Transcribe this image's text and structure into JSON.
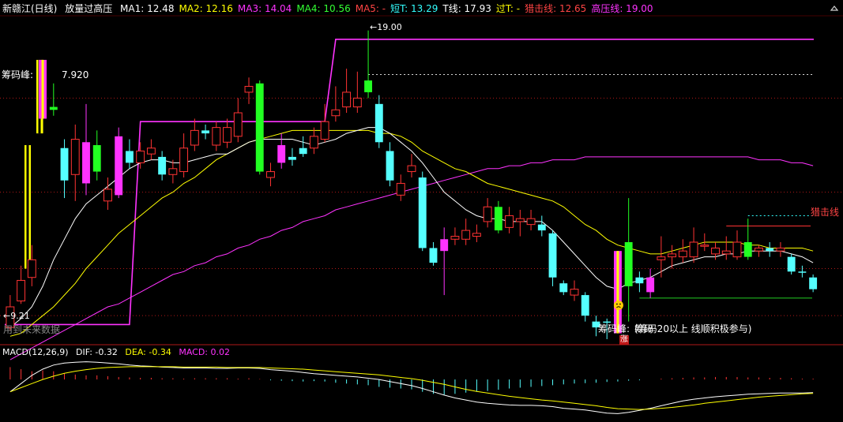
{
  "header": {
    "stock": "新赣江(日线)",
    "indicator": "放量过高压",
    "ma": [
      {
        "text": "MA1: 12.48",
        "color": "#ffffff"
      },
      {
        "text": "MA2: 12.16",
        "color": "#ffff00"
      },
      {
        "text": "MA3: 14.04",
        "color": "#ff33ff"
      },
      {
        "text": "MA4: 10.56",
        "color": "#33ff33"
      },
      {
        "text": "MA5: -",
        "color": "#ff4444"
      }
    ],
    "extra": [
      {
        "text": "短T: 13.29",
        "color": "#33ffff"
      },
      {
        "text": "T线: 17.93",
        "color": "#ffffff"
      },
      {
        "text": "过T: -",
        "color": "#ffff00"
      },
      {
        "text": "猎击线: 12.65",
        "color": "#ff4444"
      },
      {
        "text": "高压线: 19.00",
        "color": "#ff33ff"
      }
    ]
  },
  "labels": {
    "chip_peak_left": "筹码峰:",
    "chip_peak_value": "7.920",
    "high_marker": "←19.00",
    "low_marker": "←9.21",
    "future_data": "用到未来数据",
    "right_line": "猎击线",
    "chip_peak_bottom": "筹码峰:",
    "chip_note": "(筹码20以上 线顺积极参与)",
    "chip_overlap": "筹码",
    "rise_badge": "涨",
    "face_icon": "sad-face-icon"
  },
  "macd": {
    "title": "MACD(12,26,9)",
    "dif": "DIF: -0.32",
    "dea": "DEA: -0.34",
    "macd": "MACD: 0.02"
  },
  "colors": {
    "up": "#ff3333",
    "down": "#55ffff",
    "green": "#22ff22",
    "magenta": "#ff33ff",
    "yellow": "#ffff00",
    "white": "#ffffff",
    "grid": "#b01818"
  },
  "chart_data": {
    "type": "candlestick",
    "y_range": [
      8.8,
      19.8
    ],
    "resistance_line": 19.0,
    "stop_line": 12.65,
    "candles": [
      {
        "o": 9.2,
        "c": 9.9,
        "h": 10.3,
        "l": 9.1,
        "t": "up"
      },
      {
        "o": 10.1,
        "c": 10.8,
        "h": 11.3,
        "l": 10.0,
        "t": "up"
      },
      {
        "o": 10.9,
        "c": 11.5,
        "h": 12.0,
        "l": 10.6,
        "t": "up"
      },
      {
        "o": 18.3,
        "c": 16.3,
        "h": 18.3,
        "l": 15.8,
        "t": "yellow"
      },
      {
        "o": 16.7,
        "c": 16.6,
        "h": 17.5,
        "l": 16.4,
        "t": "green"
      },
      {
        "o": 15.3,
        "c": 14.2,
        "h": 15.6,
        "l": 13.6,
        "t": "down"
      },
      {
        "o": 14.4,
        "c": 15.6,
        "h": 16.1,
        "l": 13.5,
        "t": "up"
      },
      {
        "o": 15.5,
        "c": 14.1,
        "h": 16.8,
        "l": 13.7,
        "t": "magenta"
      },
      {
        "o": 14.5,
        "c": 15.4,
        "h": 15.9,
        "l": 14.2,
        "t": "green"
      },
      {
        "o": 13.5,
        "c": 13.9,
        "h": 14.3,
        "l": 13.2,
        "t": "up"
      },
      {
        "o": 13.7,
        "c": 15.7,
        "h": 16.0,
        "l": 13.6,
        "t": "magenta"
      },
      {
        "o": 15.2,
        "c": 14.8,
        "h": 15.6,
        "l": 14.6,
        "t": "down"
      },
      {
        "o": 14.8,
        "c": 15.2,
        "h": 15.5,
        "l": 14.6,
        "t": "up"
      },
      {
        "o": 15.3,
        "c": 15.1,
        "h": 15.6,
        "l": 14.9,
        "t": "up"
      },
      {
        "o": 15.0,
        "c": 14.4,
        "h": 15.2,
        "l": 14.2,
        "t": "down"
      },
      {
        "o": 14.4,
        "c": 14.6,
        "h": 14.9,
        "l": 14.1,
        "t": "up"
      },
      {
        "o": 14.5,
        "c": 15.3,
        "h": 15.8,
        "l": 14.3,
        "t": "up"
      },
      {
        "o": 15.4,
        "c": 15.9,
        "h": 16.3,
        "l": 15.2,
        "t": "up"
      },
      {
        "o": 15.9,
        "c": 15.8,
        "h": 16.1,
        "l": 15.6,
        "t": "down"
      },
      {
        "o": 15.4,
        "c": 16.0,
        "h": 16.2,
        "l": 15.2,
        "t": "up"
      },
      {
        "o": 16.0,
        "c": 15.5,
        "h": 16.3,
        "l": 15.3,
        "t": "up"
      },
      {
        "o": 15.7,
        "c": 16.5,
        "h": 17.0,
        "l": 15.5,
        "t": "up"
      },
      {
        "o": 17.2,
        "c": 17.4,
        "h": 17.7,
        "l": 16.8,
        "t": "up"
      },
      {
        "o": 17.5,
        "c": 14.5,
        "h": 17.6,
        "l": 14.4,
        "t": "green"
      },
      {
        "o": 14.5,
        "c": 14.3,
        "h": 14.8,
        "l": 14.0,
        "t": "up"
      },
      {
        "o": 14.8,
        "c": 15.4,
        "h": 15.8,
        "l": 14.6,
        "t": "magenta"
      },
      {
        "o": 15.0,
        "c": 14.9,
        "h": 15.3,
        "l": 14.7,
        "t": "down"
      },
      {
        "o": 15.3,
        "c": 15.1,
        "h": 15.7,
        "l": 15.0,
        "t": "down"
      },
      {
        "o": 15.7,
        "c": 15.3,
        "h": 16.0,
        "l": 15.1,
        "t": "up"
      },
      {
        "o": 15.6,
        "c": 16.2,
        "h": 16.8,
        "l": 15.5,
        "t": "up"
      },
      {
        "o": 16.4,
        "c": 16.6,
        "h": 17.4,
        "l": 16.2,
        "t": "up"
      },
      {
        "o": 16.7,
        "c": 17.2,
        "h": 18.0,
        "l": 16.5,
        "t": "up"
      },
      {
        "o": 17.0,
        "c": 16.7,
        "h": 17.9,
        "l": 16.5,
        "t": "up"
      },
      {
        "o": 17.6,
        "c": 17.2,
        "h": 19.3,
        "l": 17.0,
        "t": "green"
      },
      {
        "o": 16.8,
        "c": 15.5,
        "h": 17.1,
        "l": 15.3,
        "t": "down"
      },
      {
        "o": 15.2,
        "c": 14.2,
        "h": 15.5,
        "l": 14.0,
        "t": "down"
      },
      {
        "o": 14.1,
        "c": 13.7,
        "h": 14.4,
        "l": 13.5,
        "t": "up"
      },
      {
        "o": 14.7,
        "c": 14.5,
        "h": 15.1,
        "l": 14.3,
        "t": "up"
      },
      {
        "o": 14.3,
        "c": 11.9,
        "h": 14.5,
        "l": 11.8,
        "t": "down"
      },
      {
        "o": 11.9,
        "c": 11.4,
        "h": 12.1,
        "l": 11.3,
        "t": "down"
      },
      {
        "o": 12.2,
        "c": 11.8,
        "h": 12.6,
        "l": 10.3,
        "t": "magenta"
      },
      {
        "o": 12.2,
        "c": 12.3,
        "h": 12.6,
        "l": 12.0,
        "t": "up"
      },
      {
        "o": 12.2,
        "c": 12.5,
        "h": 12.9,
        "l": 12.0,
        "t": "up"
      },
      {
        "o": 12.3,
        "c": 12.4,
        "h": 12.7,
        "l": 12.1,
        "t": "up"
      },
      {
        "o": 12.8,
        "c": 13.3,
        "h": 13.6,
        "l": 12.6,
        "t": "up"
      },
      {
        "o": 13.3,
        "c": 12.5,
        "h": 13.5,
        "l": 12.4,
        "t": "green"
      },
      {
        "o": 12.6,
        "c": 13.0,
        "h": 13.3,
        "l": 12.4,
        "t": "up"
      },
      {
        "o": 12.9,
        "c": 12.8,
        "h": 13.2,
        "l": 12.3,
        "t": "up"
      },
      {
        "o": 12.7,
        "c": 12.9,
        "h": 13.2,
        "l": 12.5,
        "t": "up"
      },
      {
        "o": 12.7,
        "c": 12.5,
        "h": 13.0,
        "l": 12.3,
        "t": "down"
      },
      {
        "o": 12.4,
        "c": 10.9,
        "h": 12.5,
        "l": 10.6,
        "t": "down"
      },
      {
        "o": 10.7,
        "c": 10.4,
        "h": 10.8,
        "l": 10.3,
        "t": "down"
      },
      {
        "o": 10.5,
        "c": 10.3,
        "h": 10.8,
        "l": 10.1,
        "t": "up"
      },
      {
        "o": 10.3,
        "c": 9.6,
        "h": 10.4,
        "l": 9.4,
        "t": "down"
      },
      {
        "o": 9.4,
        "c": 9.2,
        "h": 9.6,
        "l": 8.9,
        "t": "down"
      },
      {
        "o": 9.4,
        "c": 9.4,
        "h": 9.5,
        "l": 8.8,
        "t": "down"
      },
      {
        "o": 11.8,
        "c": 9.0,
        "h": 11.8,
        "l": 9.0,
        "t": "yellow"
      },
      {
        "o": 10.6,
        "c": 12.1,
        "h": 13.6,
        "l": 9.4,
        "t": "green"
      },
      {
        "o": 10.9,
        "c": 10.7,
        "h": 11.1,
        "l": 10.4,
        "t": "down"
      },
      {
        "o": 10.4,
        "c": 10.9,
        "h": 11.2,
        "l": 10.2,
        "t": "magenta"
      },
      {
        "o": 11.5,
        "c": 11.6,
        "h": 12.3,
        "l": 10.9,
        "t": "up"
      },
      {
        "o": 11.6,
        "c": 11.7,
        "h": 12.0,
        "l": 11.2,
        "t": "up"
      },
      {
        "o": 11.8,
        "c": 11.6,
        "h": 12.2,
        "l": 11.4,
        "t": "up"
      },
      {
        "o": 11.6,
        "c": 12.1,
        "h": 12.6,
        "l": 11.4,
        "t": "up"
      },
      {
        "o": 12.0,
        "c": 12.0,
        "h": 12.4,
        "l": 11.8,
        "t": "up"
      },
      {
        "o": 11.7,
        "c": 11.9,
        "h": 12.1,
        "l": 11.5,
        "t": "up"
      },
      {
        "o": 11.8,
        "c": 11.7,
        "h": 12.3,
        "l": 11.5,
        "t": "up"
      },
      {
        "o": 11.6,
        "c": 12.1,
        "h": 12.5,
        "l": 11.5,
        "t": "up"
      },
      {
        "o": 12.1,
        "c": 11.6,
        "h": 12.9,
        "l": 11.5,
        "t": "green"
      },
      {
        "o": 11.8,
        "c": 11.9,
        "h": 12.0,
        "l": 11.6,
        "t": "up"
      },
      {
        "o": 11.9,
        "c": 11.8,
        "h": 12.1,
        "l": 11.6,
        "t": "down"
      },
      {
        "o": 11.9,
        "c": 11.8,
        "h": 12.1,
        "l": 11.6,
        "t": "up"
      },
      {
        "o": 11.6,
        "c": 11.1,
        "h": 11.7,
        "l": 11.0,
        "t": "down"
      },
      {
        "o": 11.1,
        "c": 11.1,
        "h": 11.3,
        "l": 10.9,
        "t": "down"
      },
      {
        "o": 10.9,
        "c": 10.5,
        "h": 11.0,
        "l": 10.4,
        "t": "down"
      }
    ],
    "ma_white": [
      9.2,
      9.5,
      9.9,
      10.6,
      11.5,
      12.2,
      12.9,
      13.4,
      13.7,
      14.0,
      14.3,
      14.6,
      14.8,
      14.9,
      14.9,
      14.8,
      14.8,
      14.9,
      15.0,
      15.1,
      15.1,
      15.3,
      15.5,
      15.6,
      15.6,
      15.6,
      15.6,
      15.5,
      15.4,
      15.5,
      15.6,
      15.8,
      15.9,
      16.0,
      16.0,
      15.8,
      15.5,
      15.2,
      14.8,
      14.3,
      13.8,
      13.5,
      13.2,
      13.0,
      12.9,
      12.9,
      12.8,
      12.8,
      12.8,
      12.8,
      12.5,
      12.1,
      11.7,
      11.3,
      10.9,
      10.6,
      10.5,
      10.7,
      10.8,
      10.9,
      11.1,
      11.3,
      11.4,
      11.5,
      11.6,
      11.6,
      11.7,
      11.7,
      11.8,
      11.8,
      11.8,
      11.8,
      11.7,
      11.6,
      11.4
    ],
    "ma_yellow": [
      8.9,
      9.0,
      9.3,
      9.6,
      9.9,
      10.3,
      10.7,
      11.2,
      11.6,
      12.0,
      12.4,
      12.7,
      13.0,
      13.3,
      13.6,
      13.8,
      14.1,
      14.3,
      14.6,
      14.9,
      15.1,
      15.3,
      15.5,
      15.6,
      15.7,
      15.8,
      15.9,
      15.9,
      15.9,
      15.9,
      15.9,
      15.9,
      15.9,
      15.9,
      15.8,
      15.8,
      15.7,
      15.5,
      15.2,
      15.0,
      14.8,
      14.6,
      14.5,
      14.3,
      14.1,
      14.0,
      13.9,
      13.8,
      13.7,
      13.6,
      13.5,
      13.3,
      13.0,
      12.7,
      12.5,
      12.2,
      12.0,
      11.9,
      11.8,
      11.7,
      11.7,
      11.8,
      11.9,
      12.0,
      12.1,
      12.1,
      12.1,
      12.1,
      12.0,
      12.0,
      11.9,
      11.9,
      11.9,
      11.9,
      11.8
    ],
    "ma_magenta": [
      8.1,
      8.3,
      8.5,
      8.7,
      8.9,
      9.1,
      9.3,
      9.5,
      9.7,
      9.9,
      10.0,
      10.2,
      10.4,
      10.6,
      10.8,
      11.0,
      11.1,
      11.3,
      11.4,
      11.6,
      11.7,
      11.9,
      12.0,
      12.2,
      12.3,
      12.5,
      12.6,
      12.8,
      12.9,
      13.0,
      13.2,
      13.3,
      13.4,
      13.5,
      13.6,
      13.7,
      13.8,
      13.9,
      14.0,
      14.1,
      14.2,
      14.3,
      14.4,
      14.5,
      14.6,
      14.6,
      14.7,
      14.7,
      14.8,
      14.8,
      14.9,
      14.9,
      14.9,
      15.0,
      15.0,
      15.0,
      15.0,
      15.0,
      15.0,
      15.0,
      15.0,
      15.0,
      15.0,
      15.0,
      15.0,
      15.0,
      15.0,
      15.0,
      15.0,
      14.9,
      14.9,
      14.9,
      14.8,
      14.8,
      14.7
    ],
    "step_line": [
      9.3,
      9.3,
      9.3,
      9.3,
      9.3,
      9.3,
      9.3,
      9.3,
      9.3,
      9.3,
      9.3,
      9.3,
      16.2,
      16.2,
      16.2,
      16.2,
      16.2,
      16.2,
      16.2,
      16.2,
      16.2,
      16.2,
      16.2,
      16.2,
      16.2,
      16.2,
      16.2,
      16.2,
      16.2,
      16.2,
      19.0,
      19.0,
      19.0,
      19.0,
      19.0,
      19.0,
      19.0,
      19.0,
      19.0,
      19.0,
      19.0,
      19.0,
      19.0,
      19.0,
      19.0,
      19.0,
      19.0,
      19.0,
      19.0,
      19.0,
      19.0,
      19.0,
      19.0,
      19.0,
      19.0,
      19.0,
      19.0,
      19.0,
      19.0,
      19.0,
      19.0,
      19.0,
      19.0,
      19.0,
      19.0,
      19.0,
      19.0,
      19.0,
      19.0,
      19.0,
      19.0,
      19.0,
      19.0,
      19.0,
      19.0
    ],
    "macd_hist": [
      0.3,
      0.25,
      0.2,
      0.22,
      0.2,
      0.15,
      0.12,
      0.1,
      0.1,
      0.08,
      0.06,
      0.05,
      0.04,
      0.04,
      0.03,
      0.03,
      0.02,
      0.03,
      0.03,
      0.03,
      0.03,
      0.02,
      0.03,
      0.01,
      -0.02,
      -0.03,
      -0.04,
      -0.05,
      -0.04,
      -0.05,
      -0.08,
      -0.1,
      -0.12,
      -0.14,
      -0.18,
      -0.2,
      -0.22,
      -0.24,
      -0.3,
      -0.35,
      -0.37,
      -0.35,
      -0.32,
      -0.3,
      -0.28,
      -0.25,
      -0.22,
      -0.2,
      -0.18,
      -0.16,
      -0.14,
      -0.12,
      -0.1,
      -0.09,
      -0.08,
      -0.06,
      -0.05,
      -0.03,
      -0.02,
      0.0,
      0.02,
      0.03,
      0.04,
      0.05,
      0.05,
      0.06,
      0.06,
      0.06,
      0.05,
      0.05,
      0.04,
      0.04,
      0.03,
      0.02,
      0.02
    ],
    "macd_dif": [
      -0.3,
      -0.1,
      0.1,
      0.25,
      0.35,
      0.4,
      0.42,
      0.43,
      0.42,
      0.4,
      0.38,
      0.35,
      0.33,
      0.32,
      0.3,
      0.29,
      0.28,
      0.28,
      0.28,
      0.27,
      0.27,
      0.28,
      0.28,
      0.27,
      0.24,
      0.22,
      0.2,
      0.17,
      0.14,
      0.12,
      0.1,
      0.08,
      0.06,
      0.03,
      0.0,
      -0.05,
      -0.1,
      -0.15,
      -0.22,
      -0.3,
      -0.38,
      -0.45,
      -0.5,
      -0.55,
      -0.58,
      -0.6,
      -0.62,
      -0.63,
      -0.63,
      -0.64,
      -0.66,
      -0.7,
      -0.72,
      -0.74,
      -0.78,
      -0.82,
      -0.83,
      -0.8,
      -0.75,
      -0.7,
      -0.64,
      -0.58,
      -0.52,
      -0.48,
      -0.45,
      -0.42,
      -0.4,
      -0.38,
      -0.36,
      -0.35,
      -0.34,
      -0.33,
      -0.33,
      -0.33,
      -0.32
    ],
    "macd_dea": [
      -0.3,
      -0.2,
      -0.1,
      0.0,
      0.08,
      0.15,
      0.2,
      0.24,
      0.27,
      0.29,
      0.3,
      0.31,
      0.31,
      0.31,
      0.31,
      0.31,
      0.3,
      0.3,
      0.3,
      0.3,
      0.29,
      0.29,
      0.29,
      0.29,
      0.28,
      0.27,
      0.26,
      0.25,
      0.23,
      0.21,
      0.19,
      0.17,
      0.15,
      0.13,
      0.11,
      0.08,
      0.05,
      0.02,
      -0.02,
      -0.07,
      -0.12,
      -0.18,
      -0.24,
      -0.29,
      -0.33,
      -0.37,
      -0.41,
      -0.44,
      -0.47,
      -0.5,
      -0.52,
      -0.55,
      -0.58,
      -0.61,
      -0.64,
      -0.68,
      -0.71,
      -0.72,
      -0.73,
      -0.72,
      -0.7,
      -0.68,
      -0.65,
      -0.62,
      -0.58,
      -0.55,
      -0.52,
      -0.49,
      -0.46,
      -0.43,
      -0.41,
      -0.39,
      -0.37,
      -0.35,
      -0.34
    ],
    "macd_range": [
      -0.9,
      0.5
    ]
  }
}
